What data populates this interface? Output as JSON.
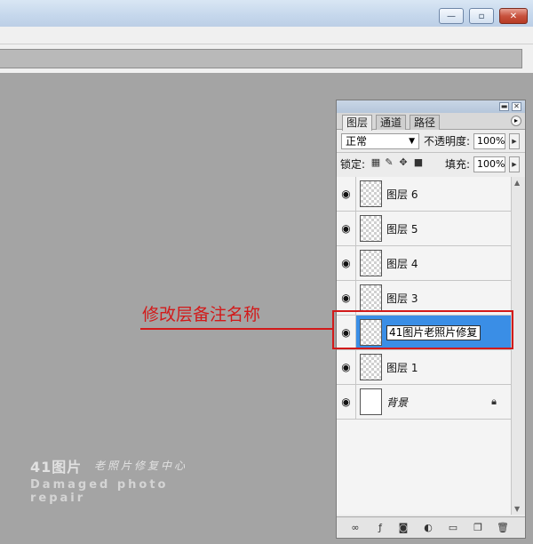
{
  "window": {
    "minimize_glyph": "—",
    "restore_glyph": "▫",
    "close_glyph": "✕"
  },
  "panel": {
    "tabs": [
      "图层",
      "通道",
      "路径"
    ],
    "blend_mode": "正常",
    "opacity_label": "不透明度:",
    "opacity_value": "100%",
    "lock_label": "锁定:",
    "fill_label": "填充:",
    "fill_value": "100%",
    "layers": [
      {
        "name": "图层 6"
      },
      {
        "name": "图层 5"
      },
      {
        "name": "图层 4"
      },
      {
        "name": "图层 3"
      },
      {
        "name": "41图片老照片修复",
        "selected": true,
        "editing": true
      },
      {
        "name": "图层 1"
      },
      {
        "name": "背景",
        "locked": true
      }
    ],
    "bottom_icons": [
      "link-icon",
      "fx-icon",
      "mask-icon",
      "adjustment-icon",
      "group-icon",
      "new-layer-icon",
      "trash-icon"
    ]
  },
  "annotation": {
    "text": "修改层备注名称",
    "color": "#d21a1a"
  },
  "watermark": {
    "line1": "41图片",
    "line1b": "老照片修复中心",
    "line2": "Damaged photo repair"
  },
  "colors": {
    "canvas_bg": "#a4a4a4",
    "selected_layer": "#3a8ee6"
  }
}
